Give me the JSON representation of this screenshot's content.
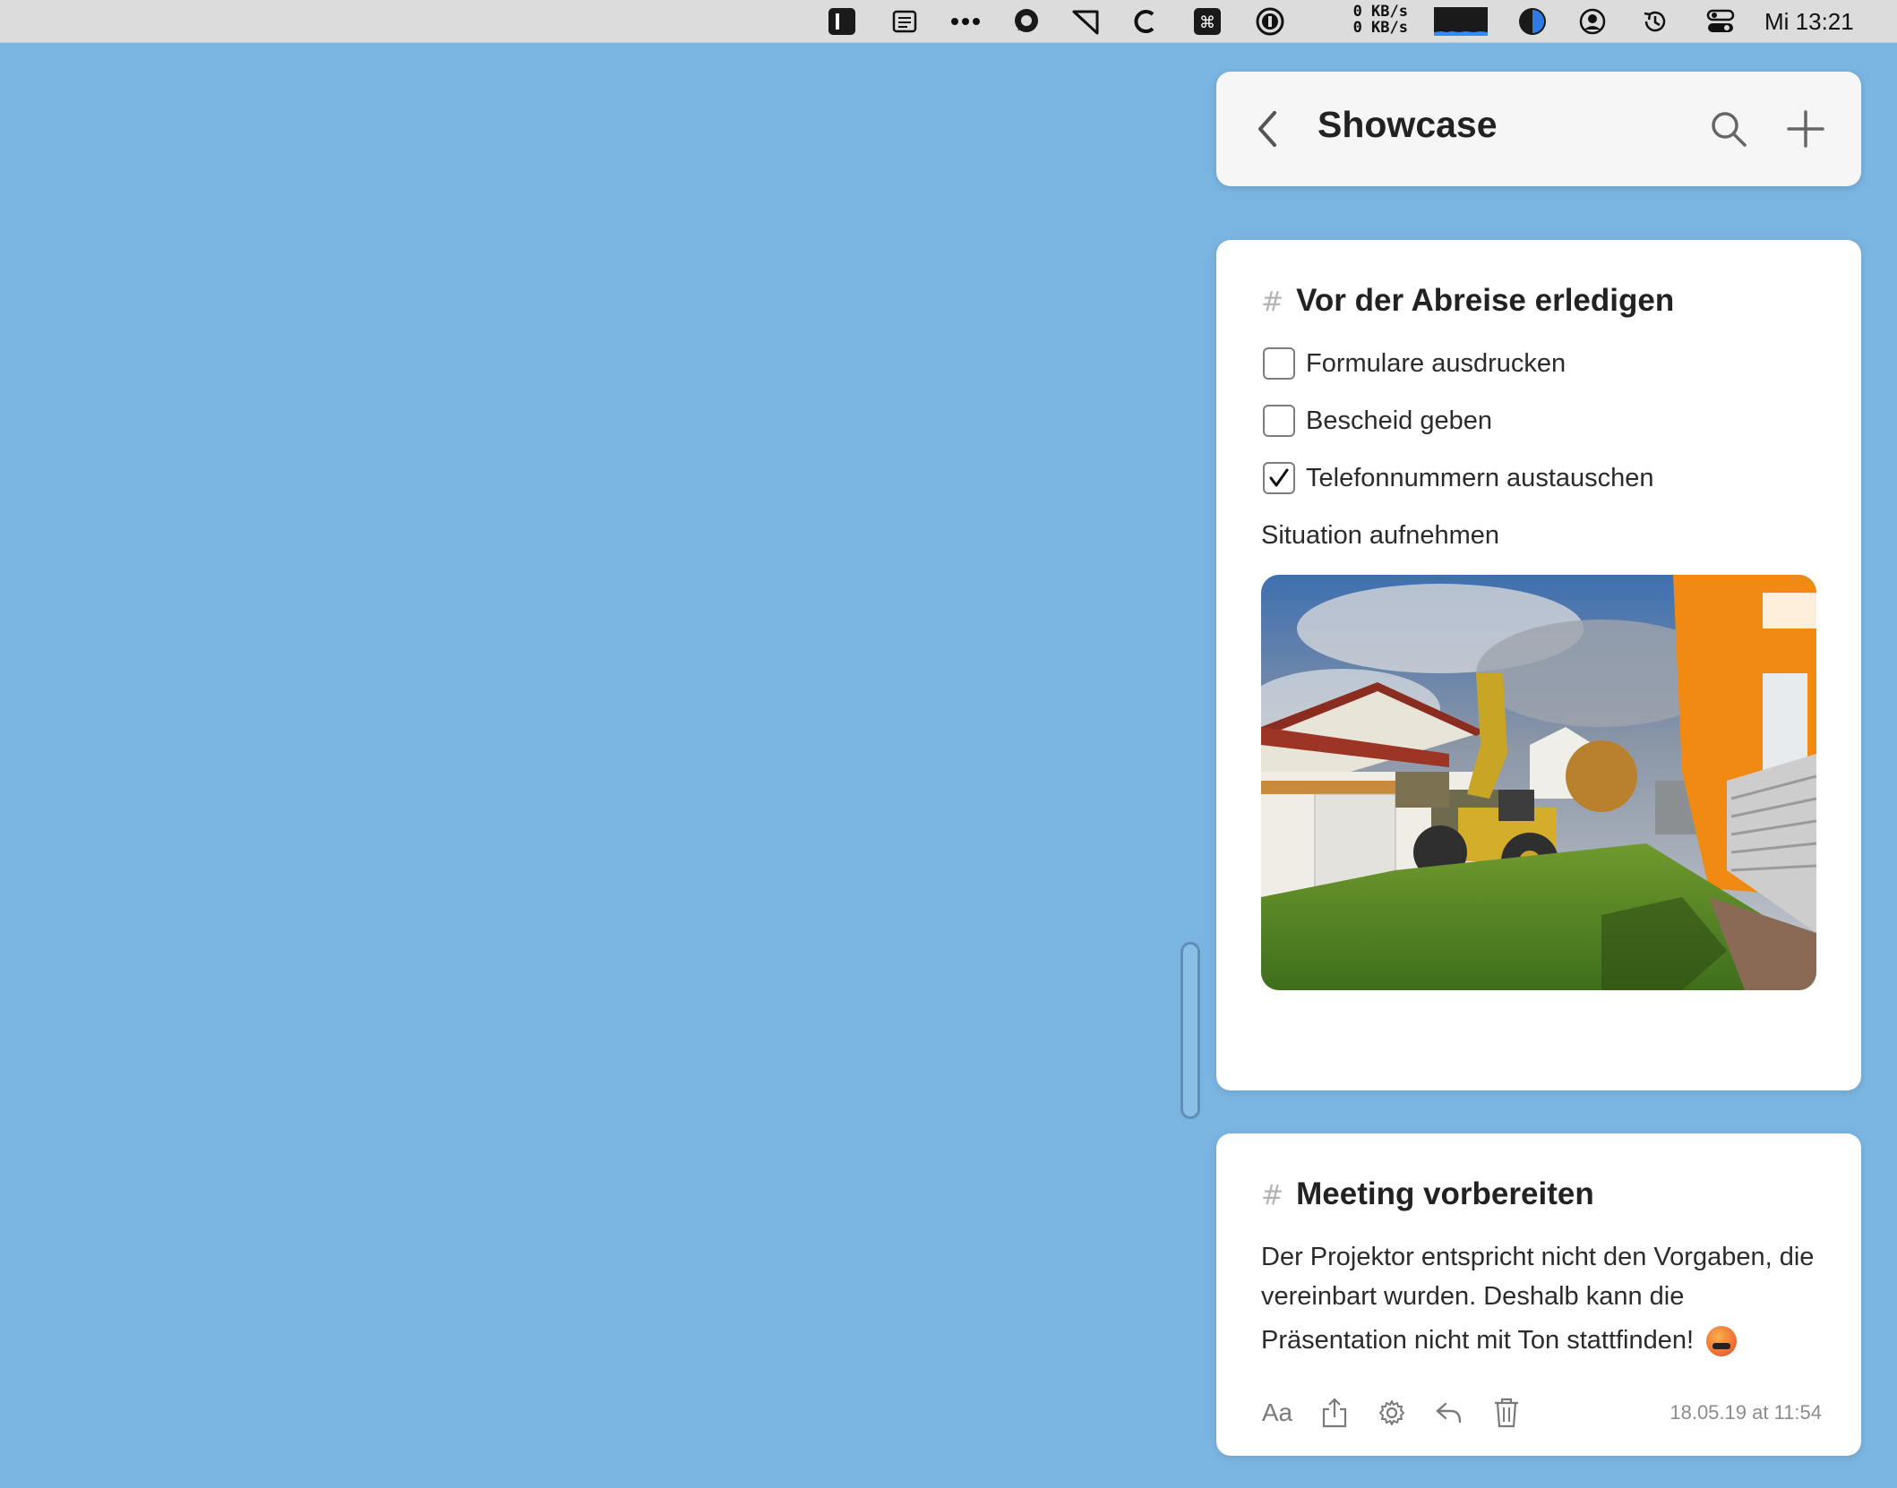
{
  "menubar": {
    "net_up": "0 KB/s",
    "net_down": "0 KB/s",
    "clock": "Mi 13:21",
    "icons": [
      "bear-icon",
      "notes-list-icon",
      "more-icon",
      "chat-icon",
      "pointer-tool-icon",
      "c-app-icon",
      "command-icon",
      "onepassword-icon",
      "network-graph-icon",
      "appearance-icon",
      "user-icon",
      "time-machine-icon",
      "control-center-icon"
    ]
  },
  "header": {
    "title": "Showcase",
    "back_icon": "chevron-left-icon",
    "search_icon": "search-icon",
    "add_icon": "plus-icon"
  },
  "notes": [
    {
      "hash": "#",
      "title": "Vor der Abreise erledigen",
      "todos": [
        {
          "label": "Formulare ausdrucken",
          "checked": false
        },
        {
          "label": "Bescheid geben",
          "checked": false
        },
        {
          "label": "Telefonnummern austauschen",
          "checked": true
        }
      ],
      "text": "Situation aufnehmen",
      "image": "construction-site-photo"
    },
    {
      "hash": "#",
      "title": "Meeting vorbereiten",
      "body_line1": "Der Projektor entspricht nicht den Vorgaben, die",
      "body_line2": "vereinbart wurden. Deshalb kann die",
      "body_line3": "Präsentation nicht mit Ton stattfinden!",
      "footer": {
        "font_label": "Aa",
        "timestamp": "18.05.19 at 11:54"
      }
    }
  ],
  "colors": {
    "desktop": "#7ab4e0",
    "card": "#ffffff",
    "header": "#f6f6f6"
  }
}
